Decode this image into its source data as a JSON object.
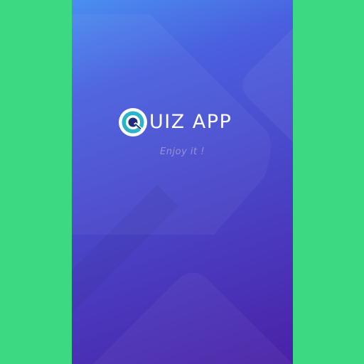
{
  "splash": {
    "brand": {
      "logo_letter": "Q",
      "name": "UIZ APP"
    },
    "tagline": "Enjoy it !"
  },
  "colors": {
    "outer_background": "#3dd882",
    "gradient_top": "#4a8ff0",
    "gradient_bottom": "#4a21a6",
    "tagline": "#9a8fd4",
    "logo_teal": "#2bb3c9",
    "logo_navy": "#1f2b7a"
  },
  "icons": {
    "logo": "q-logo-icon"
  }
}
